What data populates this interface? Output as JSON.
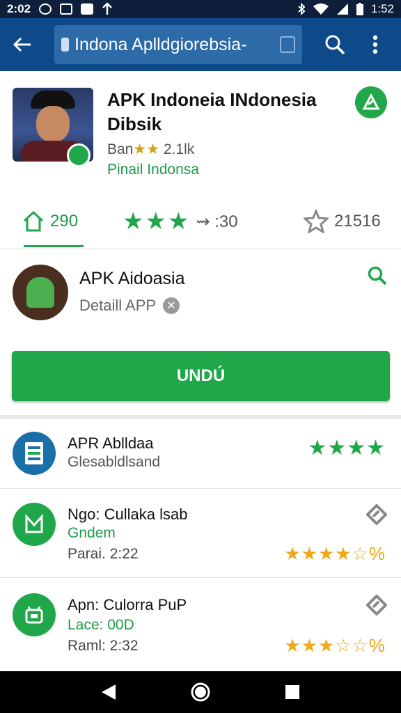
{
  "status_bar": {
    "time": "2:02",
    "clock_right": "1:52",
    "icons": [
      "whatsapp-icon",
      "gallery-icon",
      "mail-icon",
      "nav-arrow-icon",
      "bluetooth-icon",
      "wifi-icon",
      "signal-icon",
      "battery-icon"
    ]
  },
  "toolbar": {
    "url_text": "Indona Aplldgiorebsia-",
    "search_icon": "search-icon",
    "menu_icon": "more-vert-icon"
  },
  "app": {
    "title": "APK Indoneia INdonesia Dibsik",
    "meta_prefix": "Ban",
    "meta_stars": "★★",
    "meta_count": "2.1lk",
    "subtitle": "Pinail Indonsa"
  },
  "stats": {
    "installs": "290",
    "rating_stars": "★★★",
    "rating_count": "⇝ :30",
    "shares": "21516"
  },
  "detail": {
    "title": "APK Aidoasia",
    "subtitle": "Detaill APP",
    "download_label": "UNDÚ"
  },
  "list": [
    {
      "title": "APR Ablldaa",
      "subtitle": "Glesabldlsand",
      "meta": "",
      "stars": "★★★★",
      "star_color": "#1fa74a",
      "icon": "document-list-icon",
      "icon_color": "#1b6fa8"
    },
    {
      "title": "Ngo: Cullaka lsab",
      "subtitle": "Gndem",
      "meta": "Parai. 2:22",
      "stars": "★★★★☆%",
      "star_color": "#f0a818",
      "icon": "app-m-icon",
      "icon_color": "#1fa74a"
    },
    {
      "title": "Apn: Culorra PuP",
      "subtitle": "Lace: 00D",
      "meta": "Raml: 2:32",
      "stars": "★★★☆☆%",
      "star_color": "#f0a818",
      "icon": "android-app-icon",
      "icon_color": "#1fa74a"
    }
  ],
  "colors": {
    "accent": "#1fa74a",
    "app_bar": "#0e4a8a",
    "status_bar": "#0d1f3a"
  }
}
